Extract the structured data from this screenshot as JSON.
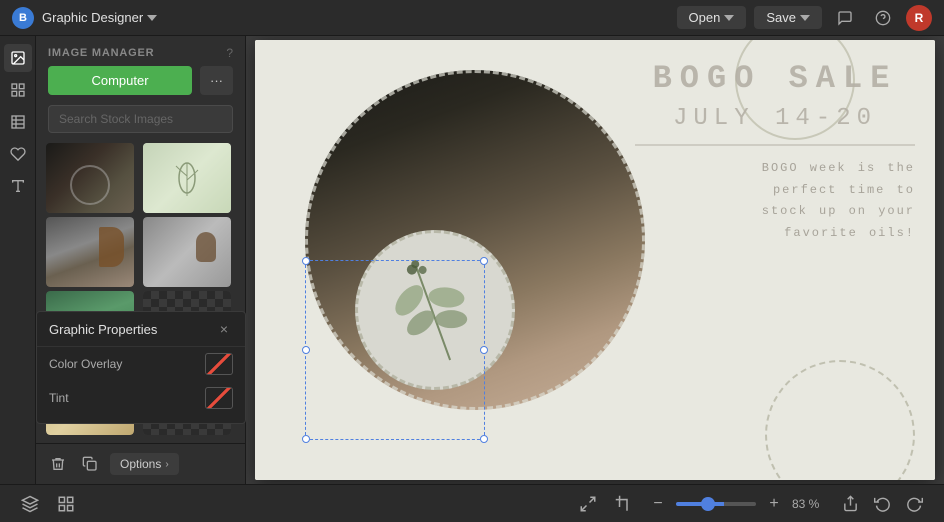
{
  "topbar": {
    "logo": "B",
    "app_name": "Graphic Designer",
    "open_label": "Open",
    "save_label": "Save"
  },
  "sidebar": {
    "header_title": "IMAGE MANAGER",
    "help_icon": "?",
    "computer_btn": "Computer",
    "more_btn": "···",
    "search_placeholder": "Search Stock Images"
  },
  "graphic_properties": {
    "title": "Graphic Properties",
    "close": "×",
    "color_overlay_label": "Color Overlay",
    "tint_label": "Tint"
  },
  "bottom_sidebar": {
    "options_label": "Options"
  },
  "canvas": {
    "title": "BOGO  SALE",
    "date": "JULY  14-20",
    "description": "BOGO week is the\nperfect time to\nstock up on your\nfavorite oils!"
  },
  "bottom_bar": {
    "zoom_percent": "83 %"
  }
}
